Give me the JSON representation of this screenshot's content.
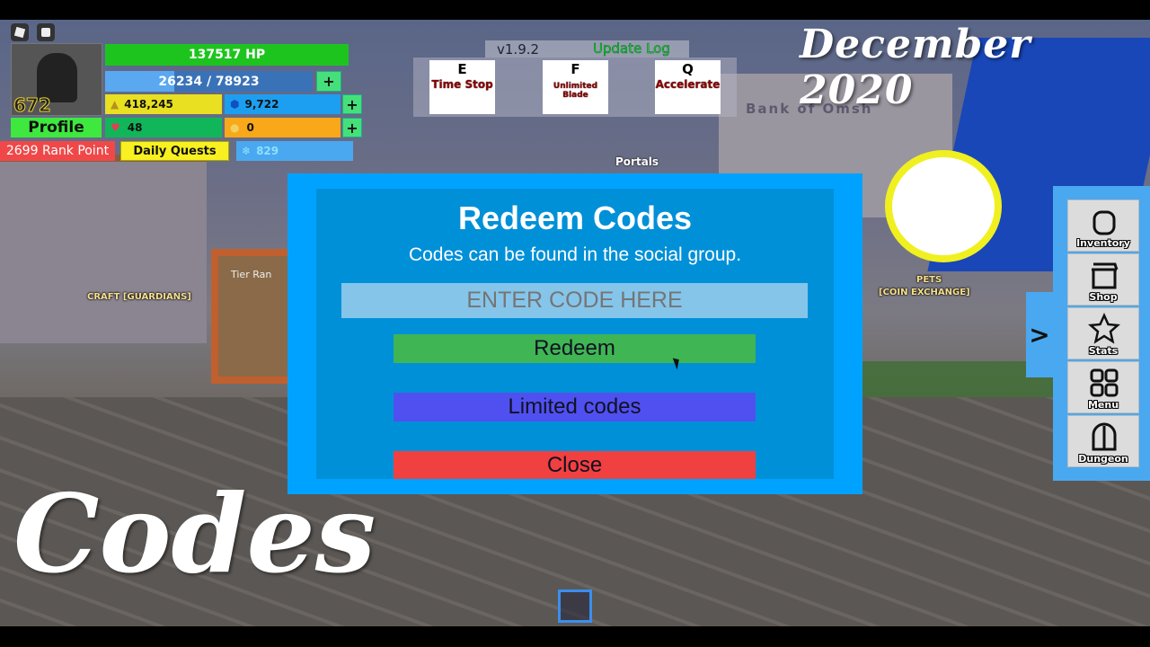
{
  "overlay": {
    "month_title": "December 2020",
    "codes_title": "Codes"
  },
  "hud": {
    "level": "672",
    "hp": "137517 HP",
    "mana": "26234 / 78923",
    "mana_fraction": 0.332,
    "gold": "418,245",
    "gems": "9,722",
    "hearts": "48",
    "coins": "0",
    "profile": "Profile",
    "rank_point": "2699 Rank Point",
    "daily_quests": "Daily Quests",
    "snow": "829",
    "plus": "+"
  },
  "top": {
    "version": "v1.9.2",
    "update_log": "Update Log",
    "portals": "Portals"
  },
  "abilities": [
    {
      "key": "E",
      "name": "Time Stop"
    },
    {
      "key": "F",
      "name": "Unlimited Blade"
    },
    {
      "key": "Q",
      "name": "Accelerate"
    }
  ],
  "scene": {
    "craft": "CRAFT [GUARDIANS]",
    "pets": "PETS",
    "pets_sub": "[COIN EXCHANGE]",
    "bank": "Bank of Omsh",
    "tier": "Tier Ran"
  },
  "modal": {
    "title": "Redeem Codes",
    "subtitle": "Codes can be found in the social group.",
    "placeholder": "ENTER CODE HERE",
    "redeem": "Redeem",
    "limited": "Limited codes",
    "close": "Close",
    "colors": {
      "frame": "#00a2ff",
      "inner": "#0090d8",
      "redeem": "#3fb554",
      "limited": "#5050f0",
      "close": "#f04040"
    }
  },
  "side": {
    "arrow": ">",
    "items": [
      {
        "label": "Inventory",
        "icon": "backpack-icon"
      },
      {
        "label": "Shop",
        "icon": "shop-icon"
      },
      {
        "label": "Stats",
        "icon": "star-icon"
      },
      {
        "label": "Menu",
        "icon": "grid-icon"
      },
      {
        "label": "Dungeon",
        "icon": "door-icon"
      }
    ]
  }
}
